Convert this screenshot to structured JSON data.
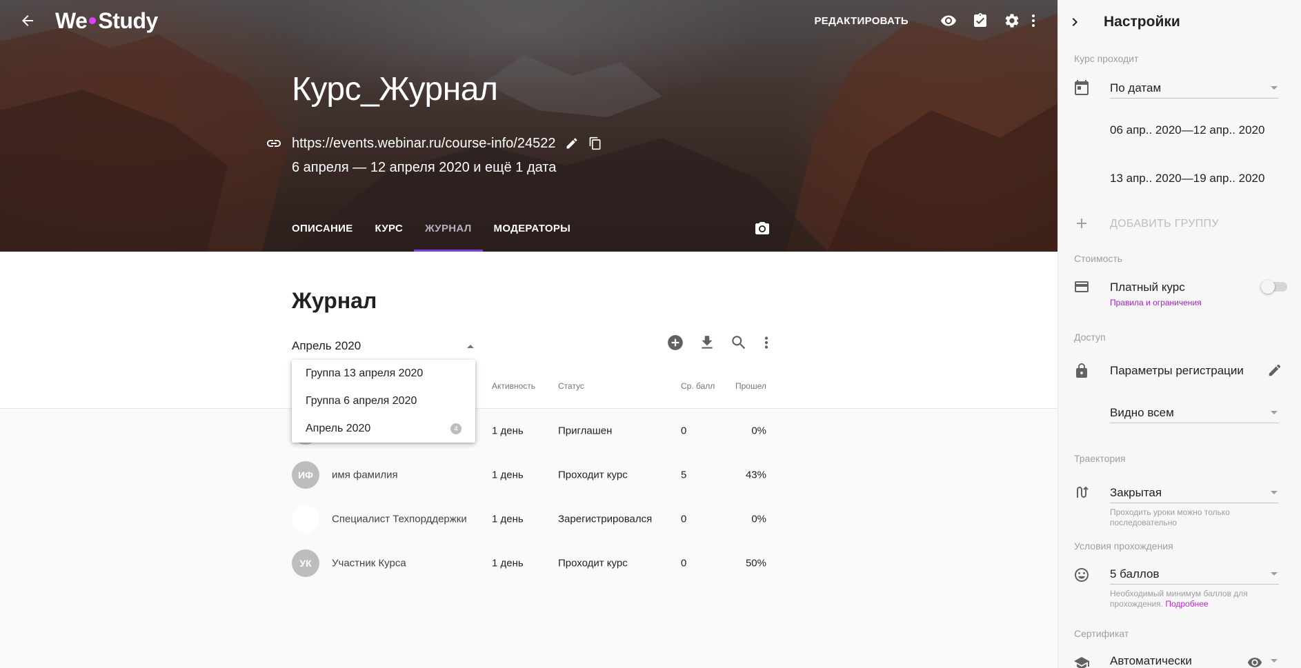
{
  "header": {
    "logo_left": "We",
    "logo_right": "Study",
    "edit_label": "РЕДАКТИРОВАТЬ"
  },
  "course": {
    "title": "Курс_Журнал",
    "url": "https://events.webinar.ru/course-info/24522",
    "dates": "6 апреля — 12 апреля 2020 и ещё 1 дата"
  },
  "tabs": [
    {
      "label": "ОПИСАНИЕ"
    },
    {
      "label": "КУРС"
    },
    {
      "label": "ЖУРНАЛ"
    },
    {
      "label": "МОДЕРАТОРЫ"
    }
  ],
  "journal": {
    "title": "Журнал",
    "period_value": "Апрель 2020",
    "columns": {
      "activity": "Активность",
      "status": "Статус",
      "score": "Ср. балл",
      "passed": "Прошел"
    },
    "menu": [
      {
        "label": "Группа 13 апреля 2020",
        "badge": ""
      },
      {
        "label": "Группа 6 апреля 2020",
        "badge": ""
      },
      {
        "label": "Апрель 2020",
        "badge": "4"
      }
    ],
    "rows": [
      {
        "initials": "",
        "name": "",
        "activity": "1 день",
        "status": "Приглашен",
        "score": "0",
        "passed": "0%"
      },
      {
        "initials": "ИФ",
        "name": "имя фамилия",
        "activity": "1 день",
        "status": "Проходит курс",
        "score": "5",
        "passed": "43%"
      },
      {
        "initials": "",
        "name": "Специалист Техпорддержки",
        "activity": "1 день",
        "status": "Зарегистрировался",
        "score": "0",
        "passed": "0%"
      },
      {
        "initials": "УК",
        "name": "Участник Курса",
        "activity": "1 день",
        "status": "Проходит курс",
        "score": "0",
        "passed": "50%"
      }
    ]
  },
  "settings": {
    "title": "Настройки",
    "schedule": {
      "label": "Курс проходит",
      "value": "По датам",
      "groups": [
        "06 апр.. 2020—12 апр.. 2020",
        "13 апр.. 2020—19 апр.. 2020"
      ],
      "add_group": "ДОБАВИТЬ ГРУППУ"
    },
    "price": {
      "label": "Стоимость",
      "paid": "Платный курс",
      "rules_link": "Правила и ограничения",
      "paid_enabled": false
    },
    "access": {
      "label": "Доступ",
      "registration": "Параметры регистрации",
      "visibility": "Видно всем"
    },
    "trajectory": {
      "label": "Траектория",
      "value": "Закрытая",
      "help": "Проходить уроки можно только последовательно"
    },
    "conditions": {
      "label": "Условия прохождения",
      "value": "5 баллов",
      "help": "Необходимый минимум баллов для прохождения.",
      "more": "Подробнее"
    },
    "certificate": {
      "label": "Сертификат",
      "value": "Автоматически"
    }
  },
  "colors": {
    "accent": "#7b3fe4",
    "logo_dot": "#e040fb",
    "link": "#a020c8"
  }
}
